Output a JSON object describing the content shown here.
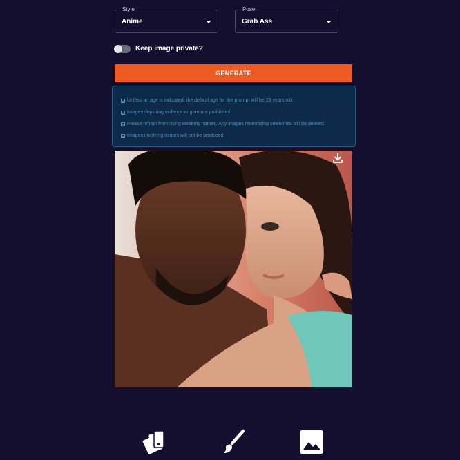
{
  "style_select": {
    "label": "Style",
    "value": "Anime"
  },
  "pose_select": {
    "label": "Pose",
    "value": "Grab Ass"
  },
  "privacy_toggle": {
    "label": "Keep image private?",
    "checked": false
  },
  "generate_button": {
    "label": "GENERATE"
  },
  "rules": [
    "Unless an age is indicated, the default age for the prompt will be 25 years old.",
    "Images depicting violence or gore are prohibited.",
    "Please refrain from using celebrity names. Any images resembling celebrities will be deleted.",
    "Images involving minors will not be produced."
  ],
  "generated_image": {
    "download_icon": "download-icon"
  },
  "bottom_nav": [
    {
      "icon": "swatch-icon"
    },
    {
      "icon": "brush-icon"
    },
    {
      "icon": "image-icon"
    }
  ],
  "colors": {
    "background": "#140f2e",
    "accent": "#ef5a22",
    "rules_bg": "#0e2a4a",
    "rules_text": "#4f8fb5"
  }
}
